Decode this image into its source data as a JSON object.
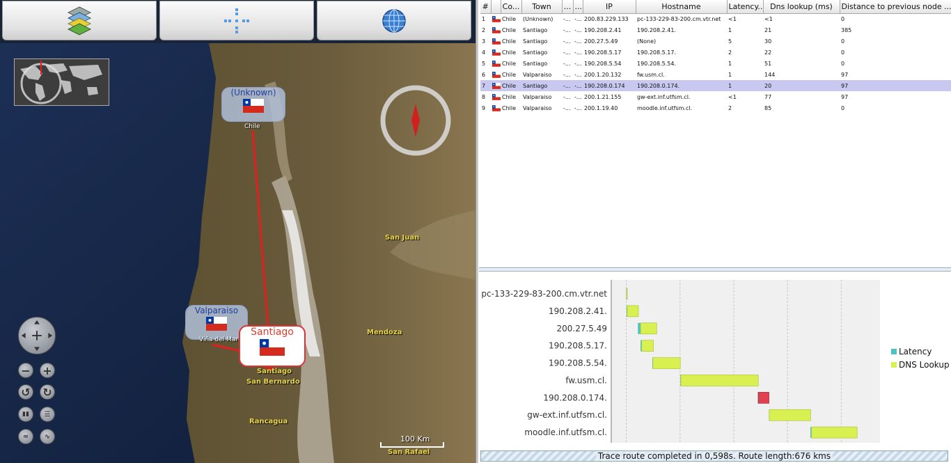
{
  "toolbar": {
    "buttons": [
      {
        "name": "layers-button",
        "icon": "layers-icon"
      },
      {
        "name": "crosshair-button",
        "icon": "crosshair-icon"
      },
      {
        "name": "globe-button",
        "icon": "globe-icon"
      }
    ]
  },
  "map": {
    "places": [
      {
        "label": "San Juan"
      },
      {
        "label": "Mendoza"
      },
      {
        "label": "Santiago"
      },
      {
        "label": "San Bernardo"
      },
      {
        "label": "Rancagua"
      },
      {
        "label": "San Rafael"
      }
    ],
    "balloons": [
      {
        "label": "(Unknown)",
        "country": "Chile"
      },
      {
        "label": "Valparaiso",
        "country": "Viña del Mar"
      },
      {
        "label": "Santiago"
      }
    ],
    "scale_label": "100 Km",
    "route_color": "#e02020",
    "nav_controls": [
      "zoom-out-icon",
      "zoom-in-icon",
      "rotate-left-icon",
      "rotate-right-icon",
      "tilt-icon",
      "tilt-reset-icon",
      "elevation-icon",
      "terrain-icon"
    ]
  },
  "table": {
    "columns": [
      "#",
      "",
      "Co...",
      "Town",
      "...",
      "...",
      "IP",
      "Hostname",
      "Latency...",
      "Dns lookup (ms)",
      "Distance to previous node ..."
    ],
    "rows": [
      {
        "n": "1",
        "country": "Chile",
        "town": "(Unknown)",
        "c4": "-...",
        "c5": "-...",
        "ip": "200.83.229.133",
        "host": "pc-133-229-83-200.cm.vtr.net",
        "lat": "<1",
        "dns": "<1",
        "dist": "0"
      },
      {
        "n": "2",
        "country": "Chile",
        "town": "Santiago",
        "c4": "-...",
        "c5": "-...",
        "ip": "190.208.2.41",
        "host": "190.208.2.41.",
        "lat": "1",
        "dns": "21",
        "dist": "385"
      },
      {
        "n": "3",
        "country": "Chile",
        "town": "Santiago",
        "c4": "-...",
        "c5": "-...",
        "ip": "200.27.5.49",
        "host": "(None)",
        "lat": "5",
        "dns": "30",
        "dist": "0"
      },
      {
        "n": "4",
        "country": "Chile",
        "town": "Santiago",
        "c4": "-...",
        "c5": "-...",
        "ip": "190.208.5.17",
        "host": "190.208.5.17.",
        "lat": "2",
        "dns": "22",
        "dist": "0"
      },
      {
        "n": "5",
        "country": "Chile",
        "town": "Santiago",
        "c4": "-...",
        "c5": "-...",
        "ip": "190.208.5.54",
        "host": "190.208.5.54.",
        "lat": "1",
        "dns": "51",
        "dist": "0"
      },
      {
        "n": "6",
        "country": "Chile",
        "town": "Valparaiso",
        "c4": "-...",
        "c5": "-...",
        "ip": "200.1.20.132",
        "host": "fw.usm.cl.",
        "lat": "1",
        "dns": "144",
        "dist": "97"
      },
      {
        "n": "7",
        "country": "Chile",
        "town": "Santiago",
        "c4": "-...",
        "c5": "-...",
        "ip": "190.208.0.174",
        "host": "190.208.0.174.",
        "lat": "1",
        "dns": "20",
        "dist": "97"
      },
      {
        "n": "8",
        "country": "Chile",
        "town": "Valparaiso",
        "c4": "-...",
        "c5": "-...",
        "ip": "200.1.21.155",
        "host": "gw-ext.inf.utfsm.cl.",
        "lat": "<1",
        "dns": "77",
        "dist": "97"
      },
      {
        "n": "9",
        "country": "Chile",
        "town": "Valparaiso",
        "c4": "-...",
        "c5": "-...",
        "ip": "200.1.19.40",
        "host": "moodle.inf.utfsm.cl.",
        "lat": "2",
        "dns": "85",
        "dist": "0"
      }
    ],
    "selected_row": 6
  },
  "chart_data": {
    "type": "bar",
    "categories": [
      "pc-133-229-83-200.cm.vtr.net",
      "190.208.2.41.",
      "200.27.5.49",
      "190.208.5.17.",
      "190.208.5.54.",
      "fw.usm.cl.",
      "190.208.0.174.",
      "gw-ext.inf.utfsm.cl.",
      "moodle.inf.utfsm.cl."
    ],
    "start": [
      0,
      0.5,
      21.5,
      26.5,
      48.5,
      100.5,
      244.5,
      265.5,
      342.5
    ],
    "series": [
      {
        "name": "Latency",
        "values": [
          0.5,
          1,
          5,
          2,
          1,
          1,
          1,
          0.5,
          2
        ],
        "color": "#4cc4c4"
      },
      {
        "name": "DNS Lookup",
        "values": [
          0.5,
          21,
          30,
          22,
          51,
          144,
          20,
          77,
          85
        ],
        "color": "#d8f050"
      }
    ],
    "highlight_index": 6,
    "highlight_color": "#e04050",
    "xlim": [
      -28,
      472
    ],
    "grid": true,
    "legend": "right"
  },
  "status": "Trace route completed in 0,598s. Route length:676 kms"
}
